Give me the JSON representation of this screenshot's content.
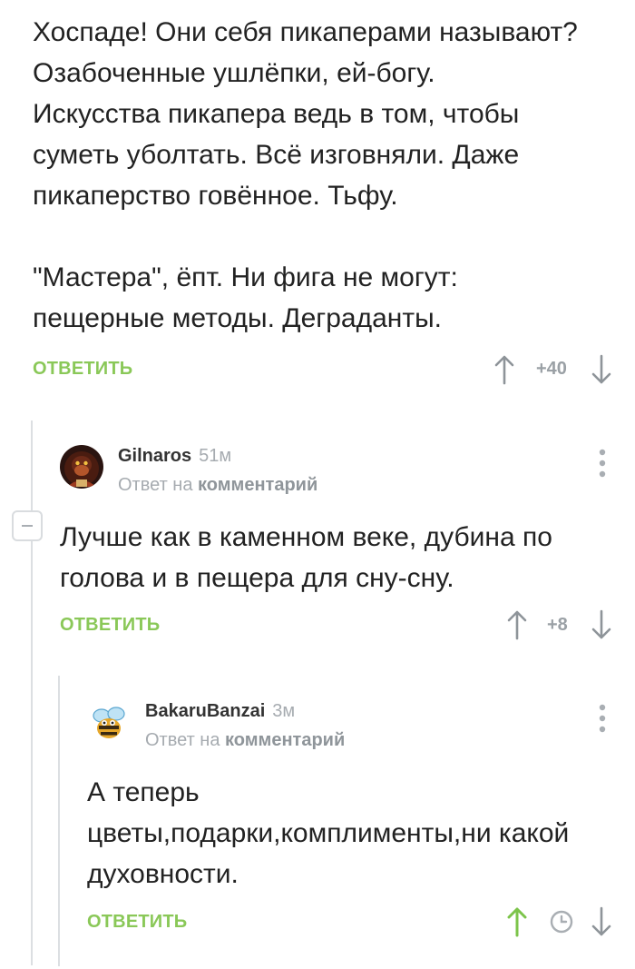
{
  "colors": {
    "accent_green": "#8ac858",
    "muted": "#9aa0a5",
    "line": "#dcdfe2"
  },
  "comments": [
    {
      "text": "Хоспаде! Они себя пикаперами называют?\nОзабоченные ушлёпки, ей-богу.\nИскусства пикапера ведь в том, чтобы\nсуметь уболтать. Всё изговняли. Даже\nпикаперство говённое. Тьфу.\n\n\"Мастера\", ёпт. Ни фига не могут:\nпещерные методы. Деграданты.",
      "reply_label": "ОТВЕТИТЬ",
      "score": "+40"
    },
    {
      "author": "Gilnaros",
      "time": "51м",
      "reply_to_prefix": "Ответ на",
      "reply_to_target": "комментарий",
      "text": "Лучше как в каменном веке, дубина по\nголова и в пещера для сну-сну.",
      "reply_label": "ОТВЕТИТЬ",
      "score": "+8",
      "avatar_icon": "gorilla-avatar"
    },
    {
      "author": "BakaruBanzai",
      "time": "3м",
      "reply_to_prefix": "Ответ на",
      "reply_to_target": "комментарий",
      "text": "А теперь\nцветы,подарки,комплименты,ни какой\nдуховности.",
      "reply_label": "ОТВЕТИТЬ",
      "upvoted": true,
      "avatar_icon": "bee-avatar"
    }
  ]
}
